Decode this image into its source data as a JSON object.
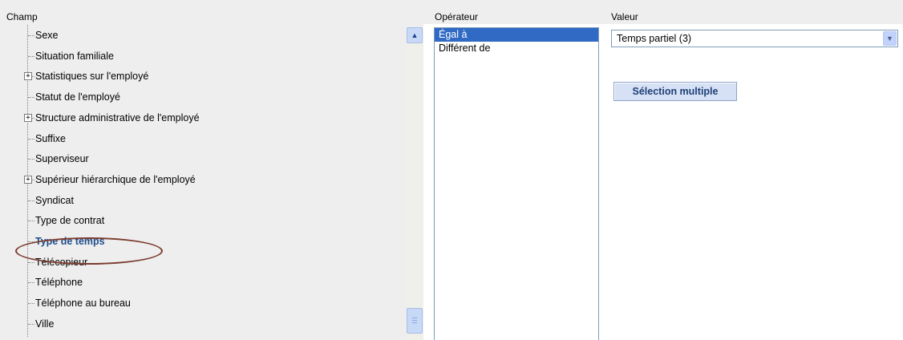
{
  "headers": {
    "champ": "Champ",
    "operateur": "Opérateur",
    "valeur": "Valeur"
  },
  "tree": {
    "items": [
      {
        "label": "Sexe",
        "expandable": false,
        "selected": false
      },
      {
        "label": "Situation familiale",
        "expandable": false,
        "selected": false
      },
      {
        "label": "Statistiques sur l'employé",
        "expandable": true,
        "selected": false
      },
      {
        "label": "Statut de l'employé",
        "expandable": false,
        "selected": false
      },
      {
        "label": "Structure administrative de l'employé",
        "expandable": true,
        "selected": false
      },
      {
        "label": "Suffixe",
        "expandable": false,
        "selected": false
      },
      {
        "label": "Superviseur",
        "expandable": false,
        "selected": false
      },
      {
        "label": "Supérieur hiérarchique de l'employé",
        "expandable": true,
        "selected": false
      },
      {
        "label": "Syndicat",
        "expandable": false,
        "selected": false
      },
      {
        "label": "Type de contrat",
        "expandable": false,
        "selected": false
      },
      {
        "label": "Type de temps",
        "expandable": false,
        "selected": true
      },
      {
        "label": "Télécopieur",
        "expandable": false,
        "selected": false
      },
      {
        "label": "Téléphone",
        "expandable": false,
        "selected": false
      },
      {
        "label": "Téléphone au bureau",
        "expandable": false,
        "selected": false
      },
      {
        "label": "Ville",
        "expandable": false,
        "selected": false
      }
    ],
    "expander_symbol": "+",
    "scroll_up_symbol": "▲"
  },
  "operators": {
    "items": [
      {
        "label": "Égal à",
        "selected": true
      },
      {
        "label": "Différent de",
        "selected": false
      }
    ]
  },
  "value": {
    "selected": "Temps partiel (3)",
    "dropdown_symbol": "▼"
  },
  "buttons": {
    "multi_select": "Sélection multiple"
  },
  "colors": {
    "selection_blue": "#316ac5",
    "selected_tree_text": "#1f4e8c",
    "annotation_circle": "#7a3b2e",
    "header_gray": "#eeeeee"
  }
}
